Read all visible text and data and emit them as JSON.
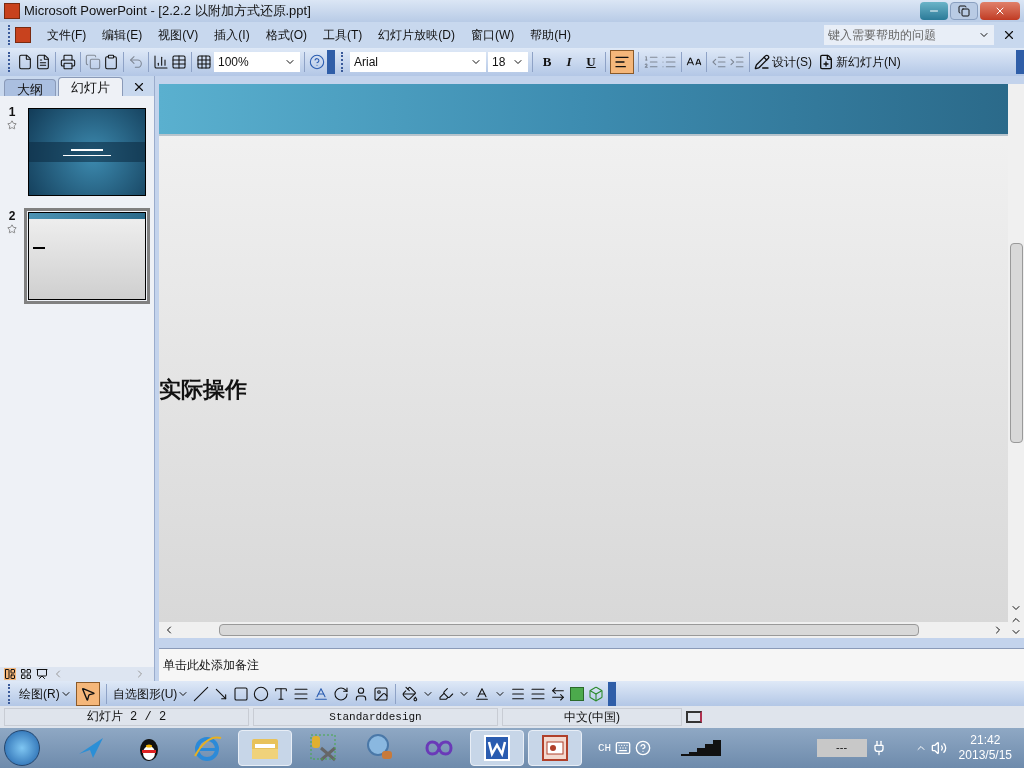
{
  "window": {
    "title": "Microsoft PowerPoint - [2.2.2 以附加方式还原.ppt]"
  },
  "menu": [
    "文件(F)",
    "编辑(E)",
    "视图(V)",
    "插入(I)",
    "格式(O)",
    "工具(T)",
    "幻灯片放映(D)",
    "窗口(W)",
    "帮助(H)"
  ],
  "help_field": {
    "placeholder": "键入需要帮助的问题"
  },
  "toolbar": {
    "zoom": "100%",
    "font": "Arial",
    "size": "18",
    "bold": "B",
    "italic": "I",
    "underline": "U",
    "align_left_selected": true,
    "design": "设计(S)",
    "new_slide": "新幻灯片(N)"
  },
  "panel_tabs": [
    {
      "label": "大纲",
      "selected": false
    },
    {
      "label": "幻灯片",
      "selected": true
    }
  ],
  "thumbnails": [
    {
      "number": "1",
      "kind": "title",
      "selected": false
    },
    {
      "number": "2",
      "kind": "content",
      "selected": true
    }
  ],
  "slide": {
    "text": "实际操作"
  },
  "notes": {
    "placeholder": "单击此处添加备注"
  },
  "drawing_toolbar": {
    "draw": "绘图(R)",
    "autoshapes": "自选图形(U)",
    "pointer_selected": true
  },
  "status_bar": [
    "幻灯片 2 / 2",
    "Standarddesign",
    "中文(中国)"
  ],
  "taskbar": {
    "apps": [
      {
        "kind": "bird",
        "selected": false
      },
      {
        "kind": "penguin",
        "selected": false
      },
      {
        "kind": "browser",
        "selected": false
      },
      {
        "kind": "folder",
        "selected": true
      },
      {
        "kind": "tools",
        "selected": false
      },
      {
        "kind": "magnifier",
        "selected": false
      },
      {
        "kind": "infinity",
        "selected": false
      },
      {
        "kind": "word",
        "selected": true
      },
      {
        "kind": "slides",
        "selected": true
      }
    ],
    "language": "CH",
    "battery": "---",
    "time": "21:42",
    "date": "2013/5/15"
  }
}
